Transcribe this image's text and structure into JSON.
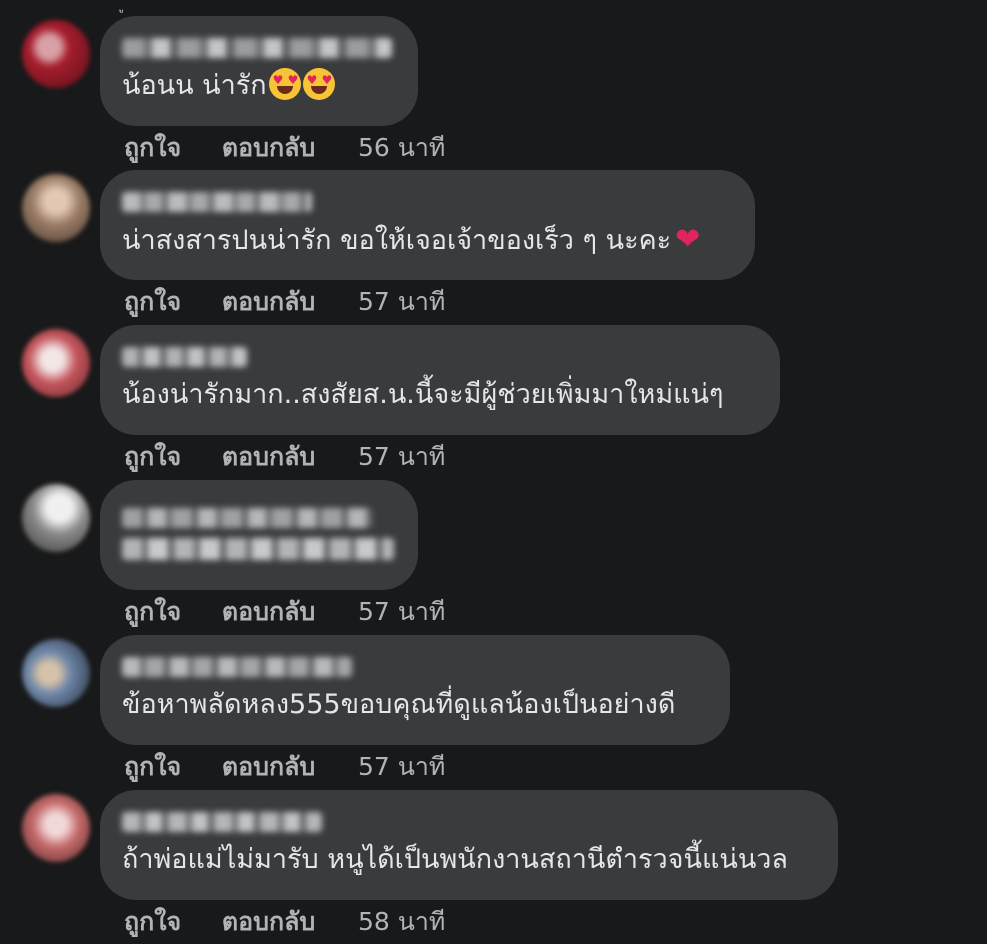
{
  "top_fragment": "ู",
  "actions": {
    "like_label": "ถูกใจ",
    "reply_label": "ตอบกลับ"
  },
  "comments": [
    {
      "author": "แดง ต้นไม้ มงคล สายใจ",
      "text": "น้อนน น่ารัก",
      "emoji": "heart-eyes-emoji x2",
      "time": "56 นาที",
      "colors": {
        "avatar": "#a01c2c"
      }
    },
    {
      "author": "Kanjana Kaitta",
      "text": "น่าสงสารปนน่ารัก ขอให้เจอเจ้าของเร็ว ๆ นะคะ",
      "emoji": "red-heart-emoji",
      "time": "57 นาที",
      "colors": {
        "avatar": "#8b7a6a"
      }
    },
    {
      "author": "pass ipsu",
      "text": "น้องน่ารักมาก..สงสัยส.น.นี้จะมีผู้ช่วยเพิ่มมาใหม่แน่ๆ",
      "time": "57 นาที",
      "colors": {
        "avatar": "#c97a6a"
      }
    },
    {
      "author": "Saadahd Samgat Puhpaphel Si Sam",
      "time": "57 นาที",
      "colors": {
        "avatar": "#8a8a8a"
      }
    },
    {
      "author": "Pithak Thimpanja",
      "text": "ข้อหาพลัดหลง555ขอบคุณที่ดูแลน้องเป็นอย่างดี",
      "time": "57 นาที",
      "colors": {
        "avatar": "#6a7d9a"
      }
    },
    {
      "author": "Sasangsai Srisgid",
      "text": "ถ้าพ่อแม่ไม่มารับ หนูได้เป็นพนักงานสถานีตำรวจนี้แน่นวล",
      "time": "58 นาที",
      "colors": {
        "avatar": "#b85a5a"
      }
    }
  ]
}
